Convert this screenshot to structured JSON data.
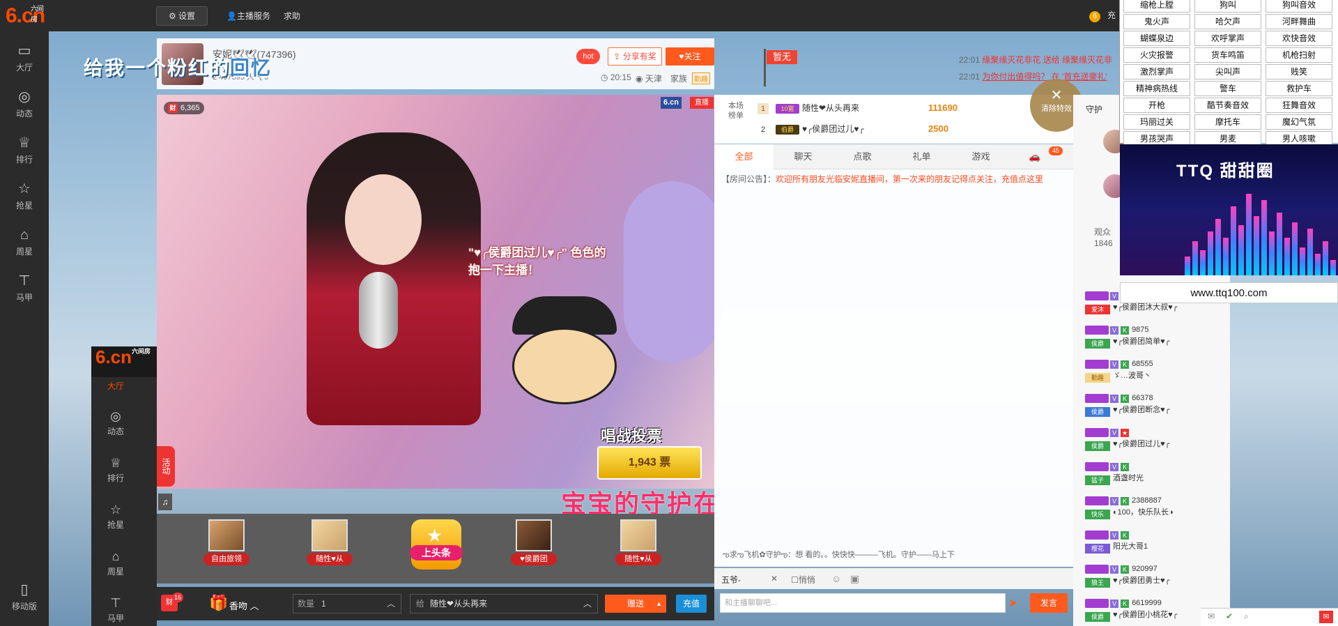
{
  "topbar": {
    "logo_text": "6.cn",
    "logo_sub": "六间房",
    "settings": "设置",
    "host_service": "主播服务",
    "help": "求助",
    "coin_text": "充"
  },
  "leftnav": [
    {
      "label": "大厅",
      "icon": "tv-icon"
    },
    {
      "label": "动态",
      "icon": "compass-icon"
    },
    {
      "label": "排行",
      "icon": "crown-icon"
    },
    {
      "label": "抢星",
      "icon": "star-icon"
    },
    {
      "label": "周星",
      "icon": "bag-icon"
    },
    {
      "label": "马甲",
      "icon": "shirt-icon"
    }
  ],
  "mobile": "移动版",
  "room": {
    "anchor_name": "安妮🕊🕊(747396)",
    "stats": "2 497393 人气 3",
    "banner_text_a": "给我一个粉红的",
    "banner_text_b": "回忆",
    "hot": "hot",
    "share": "分享有奖",
    "follow": "关注",
    "time": "20:15",
    "location": "天津",
    "family": "家族",
    "family_badge": "勤趣"
  },
  "flag": "暂无",
  "gift_feed": [
    {
      "time": "22:01",
      "text": "缘聚缘灭花非花 送给 缘聚缘灭花非"
    },
    {
      "time": "22:01",
      "text": "为你付出值得吗？ 在 '首充送豪礼'"
    }
  ],
  "video": {
    "wealth": "6,365",
    "wealth_prefix": "财",
    "logo": "6.cn",
    "live": "直播",
    "danmu_line1": "\"♥╭侯爵团过儿♥╭\" 色色的",
    "danmu_line2": "抱一下主播！",
    "scroll_text": "宝宝的守护在",
    "vote_title": "唱战投票",
    "vote_count": "1,943 票",
    "activity": "活动"
  },
  "guards": [
    {
      "label": "自由旅领"
    },
    {
      "label": "随性♥从"
    },
    {
      "label": "♥侯爵团"
    },
    {
      "label": "随性♥从"
    }
  ],
  "headline": "上头条",
  "giftbar": {
    "wealth_count": "16",
    "gift_name": "香吻",
    "qty_label": "数量",
    "qty": "1",
    "to_label": "给",
    "to_user": "随性❤从头再来",
    "give": "赠送",
    "recharge": "充值"
  },
  "mini_nav": {
    "logo": "6.cn",
    "sub": "六间房",
    "items": [
      "大厅",
      "动态",
      "排行",
      "抢星",
      "周星",
      "马甲"
    ]
  },
  "rank": {
    "label": "本场榜单",
    "rows": [
      {
        "num": "1",
        "level": "10富",
        "name": "随性❤从头再来",
        "score": "111690"
      },
      {
        "num": "2",
        "level": "伯爵",
        "name": "♥╭侯爵团过儿♥╭",
        "score": "2500"
      }
    ]
  },
  "tabs": [
    "全部",
    "聊天",
    "点歌",
    "礼单",
    "游戏"
  ],
  "car_count": "45",
  "notice": {
    "label": "【房间公告】：",
    "text": "欢迎所有朋友光临安妮直播间，第一次来的朋友记得点关注，充值点这里"
  },
  "chat_message": "ఌ求ఌ飞机✿守护ఌ：想 看的。。快快快———飞机。守护——马上下",
  "chat_input": {
    "target": "五爷-",
    "whisper": "悄悄",
    "placeholder": "和主播聊聊吧...",
    "send": "发言"
  },
  "clear_fx": "清除特效",
  "userlist": {
    "guard_label": "守护",
    "viewer_label": "观众",
    "viewer_count": "1846",
    "rows": [
      {
        "num": "",
        "tag": "爱沐",
        "name": "♥╭侯爵团沐大叔♥╭"
      },
      {
        "num": "9875",
        "tag": "侯爵",
        "name": "♥╭侯爵团简单♥╭"
      },
      {
        "num": "68555",
        "tag": "勤趣",
        "name": "ゞ…波哥丶"
      },
      {
        "num": "66378",
        "tag": "侯爵",
        "name": "♥╭侯爵团断念♥╭"
      },
      {
        "num": "",
        "tag": "侯爵",
        "name": "♥╭侯爵团过儿♥╭"
      },
      {
        "num": "",
        "tag": "猛子",
        "name": "酒盏时光"
      },
      {
        "num": "2388887",
        "tag": "快乐",
        "name": "◐100，快乐队长◑"
      },
      {
        "num": "",
        "tag": "樱花",
        "name": "阳光大哥1"
      },
      {
        "num": "920997",
        "tag": "狼王",
        "name": "♥╭侯爵团勇士♥╭"
      },
      {
        "num": "6619999",
        "tag": "侯爵",
        "name": "♥╭侯爵团小桃花♥╭"
      }
    ]
  },
  "sfx": [
    [
      "缩枪上膛",
      "狗叫",
      "狗叫音效"
    ],
    [
      "鬼火声",
      "哈欠声",
      "河畔舞曲"
    ],
    [
      "蝴蝶泉边",
      "欢呼掌声",
      "欢快音效"
    ],
    [
      "火灾报警",
      "货车鸣笛",
      "机枪扫射"
    ],
    [
      "激烈掌声",
      "尖叫声",
      "贱笑"
    ],
    [
      "精神病热线",
      "警车",
      "救护车"
    ],
    [
      "开枪",
      "酷节奏音效",
      "狂舞音效"
    ],
    [
      "玛丽过关",
      "摩托车",
      "魔幻气氛"
    ],
    [
      "男孩哭声",
      "男麦",
      "男人咳嗽"
    ]
  ],
  "ttq": {
    "title": "TTQ 甜甜圈",
    "url": "www.ttq100.com"
  }
}
